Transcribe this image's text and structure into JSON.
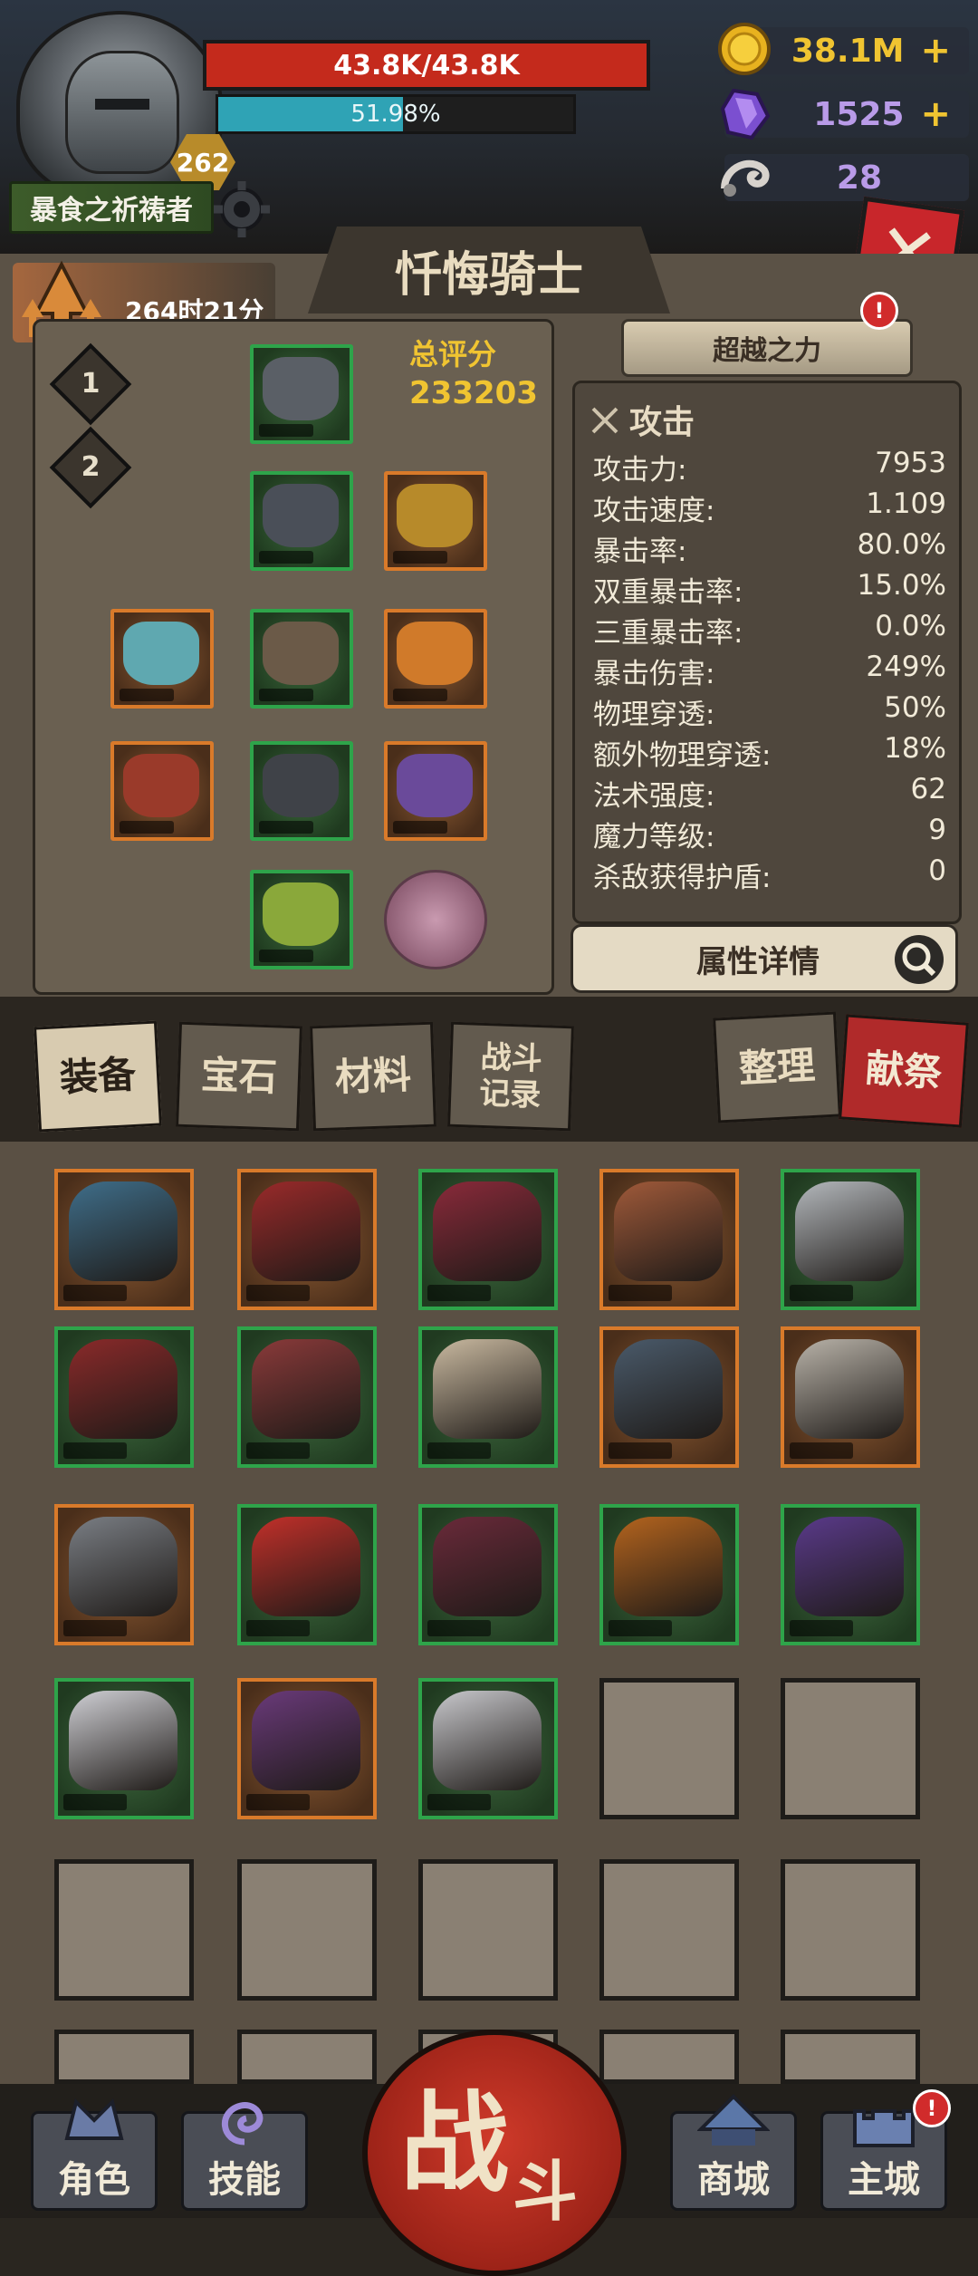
{
  "player": {
    "hp": "43.8K/43.8K",
    "xp": "51.98%",
    "xp_fraction": 0.5198,
    "level": "262",
    "title": "暴食之祈祷者"
  },
  "currencies": {
    "gold": "38.1M",
    "crystal": "1525",
    "horn": "28"
  },
  "panel": {
    "class_name": "忏悔骑士",
    "timer": "264时21分",
    "slot_tabs": [
      "1",
      "2"
    ],
    "score_label": "总评分",
    "score_value": "233203",
    "transcend_label": "超越之力",
    "transcend_alert": "!",
    "stats_header": "攻击",
    "stats": [
      {
        "k": "攻击力:",
        "v": "7953"
      },
      {
        "k": "攻击速度:",
        "v": "1.109"
      },
      {
        "k": "暴击率:",
        "v": "80.0%"
      },
      {
        "k": "双重暴击率:",
        "v": "15.0%"
      },
      {
        "k": "三重暴击率:",
        "v": "0.0%"
      },
      {
        "k": "暴击伤害:",
        "v": "249%"
      },
      {
        "k": "物理穿透:",
        "v": "50%"
      },
      {
        "k": "额外物理穿透:",
        "v": "18%"
      },
      {
        "k": "法术强度:",
        "v": "62"
      },
      {
        "k": "魔力等级:",
        "v": "9"
      },
      {
        "k": "杀敌获得护盾:",
        "v": "0"
      }
    ],
    "detail_label": "属性详情"
  },
  "tabs": {
    "equipment": "装备",
    "gems": "宝石",
    "materials": "材料",
    "battle_log_1": "战斗",
    "battle_log_2": "记录",
    "sort": "整理",
    "sacrifice": "献祭"
  },
  "nav": {
    "character": "角色",
    "skills": "技能",
    "battle_main": "战",
    "battle_sub": "斗",
    "shop": "商城",
    "main_city": "主城",
    "main_city_alert": "!"
  },
  "icons": {
    "close": "✕",
    "plus": "+"
  },
  "colors": {
    "hp": "#c42a1c",
    "xp": "#2fa3b5",
    "gold": "#f0c431",
    "crystal": "#b99be8",
    "uncommon_border": "#2ea44a",
    "rare_border": "#d97a2a"
  }
}
